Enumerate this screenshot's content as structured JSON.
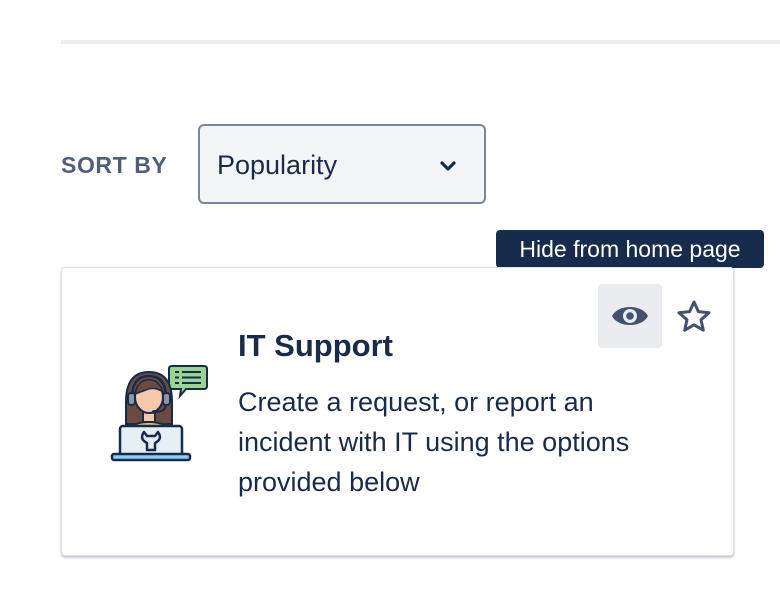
{
  "sort": {
    "label": "SORT BY",
    "selected": "Popularity"
  },
  "tooltip": {
    "text": "Hide from home page"
  },
  "card": {
    "title": "IT Support",
    "description": "Create a request, or report an incident with IT using the options provided below",
    "icons": [
      "eye-icon",
      "star-icon",
      "it-support-agent-icon",
      "chevron-down-icon"
    ]
  },
  "colors": {
    "text_primary": "#172b4d",
    "text_subtle": "#505f79",
    "tooltip_bg": "#172b4d",
    "select_bg": "#f4f5f7",
    "button_bg": "#ebecf0",
    "eye_icon": "#42526e"
  }
}
